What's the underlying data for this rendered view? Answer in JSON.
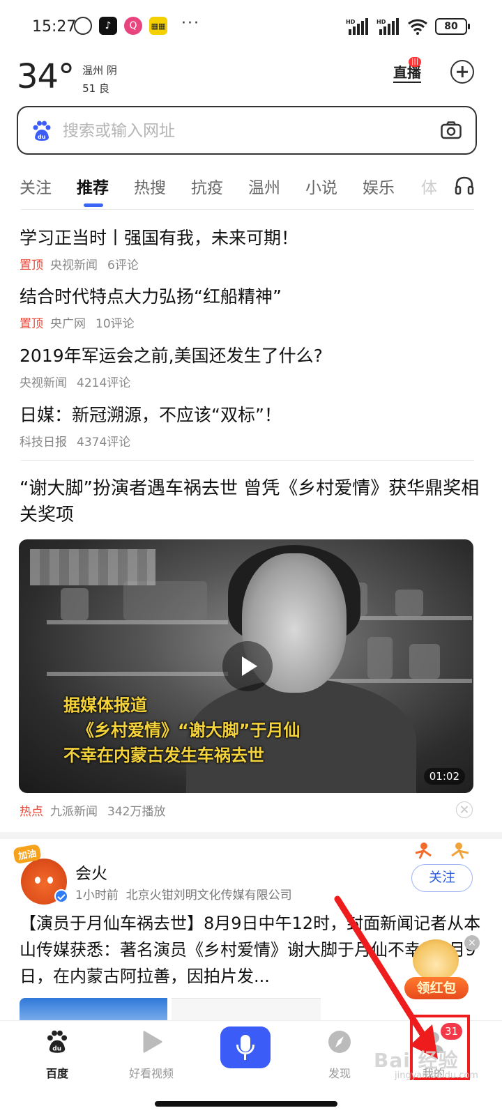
{
  "status_bar": {
    "time": "15:27",
    "battery": "80",
    "signal_1": "HD",
    "signal_2": "HD",
    "more": "···"
  },
  "weather": {
    "temperature": "34°",
    "city_condition": "温州 阴",
    "air_quality": "51 良"
  },
  "header": {
    "live_label": "直播",
    "live_badge": "|||"
  },
  "search": {
    "placeholder": "搜索或输入网址"
  },
  "tabs": [
    {
      "label": "关注"
    },
    {
      "label": "推荐"
    },
    {
      "label": "热搜"
    },
    {
      "label": "抗疫"
    },
    {
      "label": "温州"
    },
    {
      "label": "小说"
    },
    {
      "label": "娱乐"
    },
    {
      "label": "体"
    }
  ],
  "headlines": [
    {
      "title": "学习正当时丨强国有我，未来可期！",
      "pin": "置顶",
      "source": "央视新闻",
      "comments": "6评论"
    },
    {
      "title": "结合时代特点大力弘扬“红船精神”",
      "pin": "置顶",
      "source": "央广网",
      "comments": "10评论"
    },
    {
      "title": "2019年军运会之前,美国还发生了什么?",
      "pin": "",
      "source": "央视新闻",
      "comments": "4214评论"
    },
    {
      "title": "日媒：新冠溯源，不应该“双标”！",
      "pin": "",
      "source": "科技日报",
      "comments": "4374评论"
    }
  ],
  "video_card": {
    "title": "“谢大脚”扮演者遇车祸去世 曾凭《乡村爱情》获华鼎奖相关奖项",
    "caption_lines": [
      "据媒体报道",
      "《乡村爱情》“谢大脚”于月仙",
      "不幸在内蒙古发生车祸去世"
    ],
    "duration": "01:02",
    "hot_label": "热点",
    "source": "九派新闻",
    "plays": "342万播放"
  },
  "post": {
    "cheer_badge": "加油",
    "author": "会火",
    "time": "1小时前",
    "org": "北京火钳刘明文化传媒有限公司",
    "follow_label": "关注",
    "text": "【演员于月仙车祸去世】8月9日中午12时，封面新闻记者从本山传媒获悉：著名演员《乡村爱情》谢大脚于月仙不幸于8月9日，在内蒙古阿拉善，因拍片发..."
  },
  "red_packet": {
    "label": "领红包",
    "close": "×"
  },
  "bottom_nav": {
    "items": [
      {
        "label": "百度"
      },
      {
        "label": "好看视频"
      },
      {
        "label": ""
      },
      {
        "label": "发现"
      },
      {
        "label": "我的"
      }
    ],
    "badge": "31"
  },
  "watermark": {
    "text": "Bai 经验",
    "sub": "jingyan.baidu.com"
  },
  "colors": {
    "accent_blue": "#3b5cf6",
    "pin_red": "#e84a3a",
    "badge_red": "#f3384a",
    "annotation_red": "#ee1c1c"
  }
}
